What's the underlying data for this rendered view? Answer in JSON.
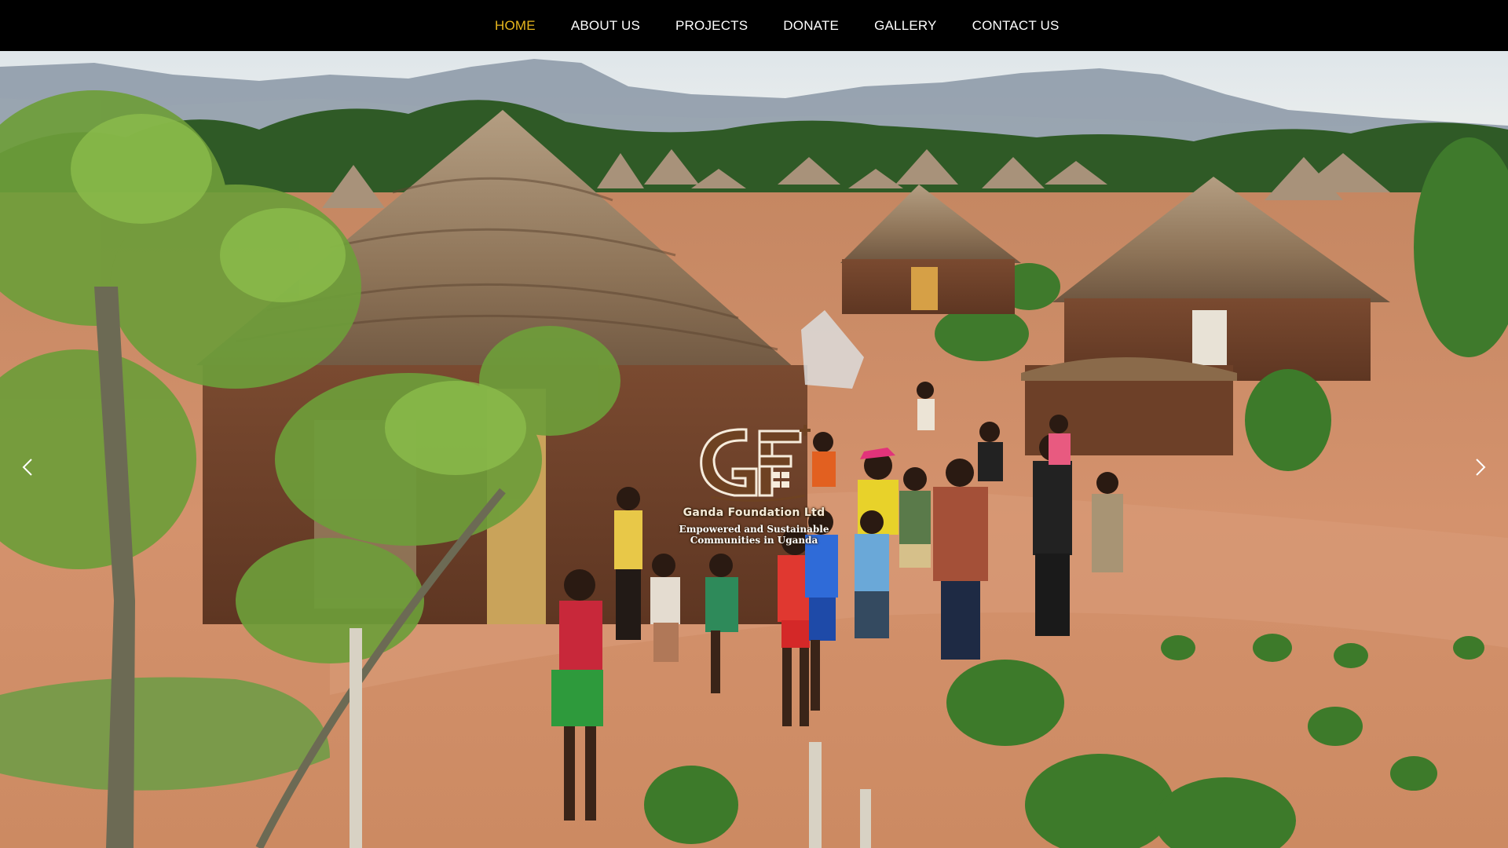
{
  "nav": {
    "items": [
      {
        "label": "HOME",
        "active": true
      },
      {
        "label": "ABOUT US",
        "active": false
      },
      {
        "label": "PROJECTS",
        "active": false
      },
      {
        "label": "DONATE",
        "active": false
      },
      {
        "label": "GALLERY",
        "active": false
      },
      {
        "label": "CONTACT US",
        "active": false
      }
    ],
    "active_color": "#e8b81e",
    "text_color": "#ffffff",
    "background": "#000000"
  },
  "hero": {
    "logo": {
      "mark": "GF",
      "name": "Ganda Foundation Ltd",
      "tagline_line1": "Empowered and Sustainable",
      "tagline_line2": "Communities in Uganda"
    },
    "prev_icon": "chevron-left-icon",
    "next_icon": "chevron-right-icon"
  }
}
